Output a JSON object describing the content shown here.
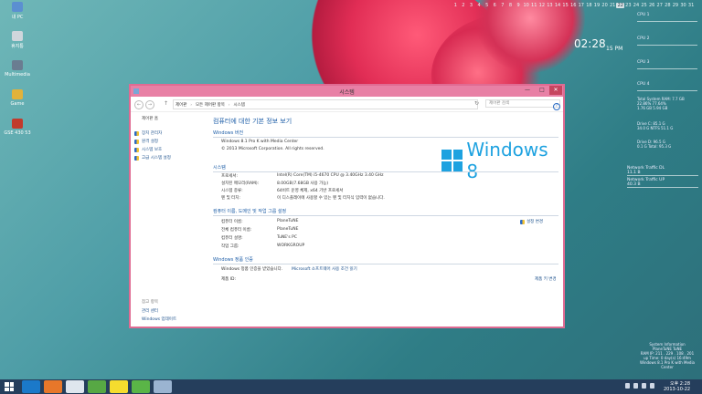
{
  "desktop": {
    "icons": [
      {
        "label": "내 PC"
      },
      {
        "label": "휴지통"
      },
      {
        "label": "Multimedia"
      },
      {
        "label": "Game"
      },
      {
        "label": "GSE 430 53"
      }
    ],
    "date_strip": [
      "1",
      "2",
      "3",
      "4",
      "5",
      "6",
      "7",
      "8",
      "9",
      "10",
      "11",
      "12",
      "13",
      "14",
      "15",
      "16",
      "17",
      "18",
      "19",
      "20",
      "21",
      "22",
      "23",
      "24",
      "25",
      "26",
      "27",
      "28",
      "29",
      "30",
      "31"
    ],
    "today_index": 21,
    "clock": {
      "time": "02:28",
      "ampm": "15 PM"
    }
  },
  "gadgets": {
    "cpu": [
      "CPU 1",
      "CPU 2",
      "CPU 3",
      "CPU 4"
    ],
    "memory": {
      "line1": "Total System RAM:      7.7 GB",
      "line2": "22.86%               77.64%",
      "line3": "1.76 GB               5.94 GB"
    },
    "drive_c": {
      "line1": "Drive C:                  85.1 G",
      "line2": "34.0 G          NTFS  51.1 G"
    },
    "drive_d": {
      "line1": "Drive D:                  96.5 G",
      "line2": "0.1 G           Total: 95.3 G"
    },
    "net_down": "Network Traffic DL",
    "net_down_val": "11.1 B",
    "net_up": "Network Traffic UP",
    "net_up_val": "40.3 B",
    "sysinfo": [
      "System Information",
      "PlaneTuNE  TuNE",
      "RAM IP: 211 . 229 . 108 . 201",
      "up Time: 0 day(s) 16:49m",
      "Windows 8.1 Pro K with Media Center"
    ]
  },
  "window": {
    "title": "시스템",
    "min": "—",
    "max": "□",
    "close": "✕",
    "breadcrumbs": [
      "제어판",
      "모든 제어판 항목",
      "시스템"
    ],
    "search_placeholder": "제어판 검색",
    "left": {
      "home": "제어판 홈",
      "tasks": [
        "장치 관리자",
        "원격 설정",
        "시스템 보호",
        "고급 시스템 설정"
      ],
      "see_also": "참고 항목",
      "see_also_items": [
        "관리 센터",
        "Windows 업데이트"
      ]
    },
    "main": {
      "heading": "컴퓨터에 대한 기본 정보 보기",
      "edition_title": "Windows 버전",
      "edition": "Windows 8.1 Pro K with Media Center",
      "copyright": "© 2013 Microsoft Corporation. All rights reserved.",
      "logo_text": "Windows 8",
      "system_title": "시스템",
      "system_rows": [
        {
          "label": "프로세서:",
          "value": "Intel(R) Core(TM) i5-4670 CPU @ 3.40GHz   3.40 GHz"
        },
        {
          "label": "설치된 메모리(RAM):",
          "value": "8.00GB(7.68GB 사용 가능)"
        },
        {
          "label": "시스템 종류:",
          "value": "64비트 운영 체제, x64 기반 프로세서"
        },
        {
          "label": "펜 및 터치:",
          "value": "이 디스플레이에 사용할 수 있는 펜 및 터치식 입력이 없습니다."
        }
      ],
      "computer_title": "컴퓨터 이름, 도메인 및 작업 그룹 설정",
      "computer_rows": [
        {
          "label": "컴퓨터 이름:",
          "value": "PlaneTuNE"
        },
        {
          "label": "전체 컴퓨터 이름:",
          "value": "PlaneTuNE"
        },
        {
          "label": "컴퓨터 설명:",
          "value": "TuNE's PC"
        },
        {
          "label": "작업 그룹:",
          "value": "WORKGROUP"
        }
      ],
      "change_settings": "설정 변경",
      "activation_title": "Windows 정품 인증",
      "activation_text": "Windows 정품 인증을 받았습니다.",
      "ms_link": "Microsoft 소프트웨어 사용 조건 읽기",
      "product_id": "제품 ID:",
      "change_key": "제품 키 변경"
    }
  },
  "taskbar": {
    "clock_time": "오후 2:28",
    "clock_date": "2013-10-22",
    "apps": [
      {
        "name": "ie",
        "color": "#1b79c9"
      },
      {
        "name": "firefox",
        "color": "#e7772a"
      },
      {
        "name": "alien",
        "color": "#dfe6ee"
      },
      {
        "name": "utorrent",
        "color": "#57a844"
      },
      {
        "name": "kakaotalk",
        "color": "#f5dc2e"
      },
      {
        "name": "green-app",
        "color": "#5ab547"
      },
      {
        "name": "explorer",
        "color": "#9bb4d1"
      }
    ]
  }
}
